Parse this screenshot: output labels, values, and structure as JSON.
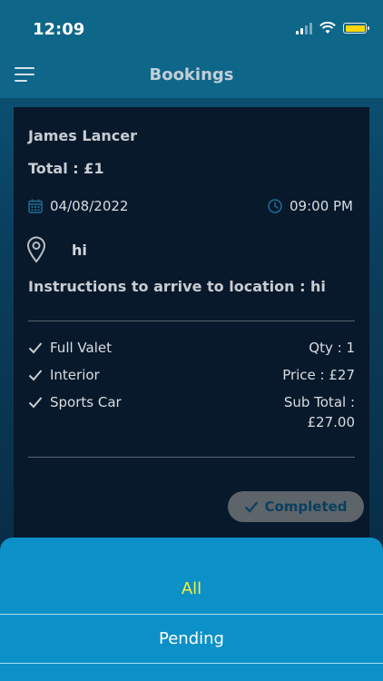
{
  "status_bar": {
    "time": "12:09"
  },
  "nav": {
    "title": "Bookings"
  },
  "booking": {
    "customer_name": "James Lancer",
    "total": "Total : £1",
    "date": "04/08/2022",
    "time": "09:00 PM",
    "location": "hi",
    "instructions": "Instructions to arrive to location : hi",
    "items": [
      {
        "label": "Full Valet"
      },
      {
        "label": "Interior"
      },
      {
        "label": "Sports Car"
      }
    ],
    "qty": "Qty : 1",
    "price": "Price : £27",
    "sub_total_label": "Sub Total :",
    "sub_total_value": "£27.00",
    "status": "Completed"
  },
  "filter_sheet": {
    "options": [
      {
        "label": "All",
        "selected": true
      },
      {
        "label": "Pending",
        "selected": false
      }
    ]
  },
  "colors": {
    "accent": "#0c90c8",
    "selected_option": "#f2f23a",
    "card_bg": "#08192b",
    "icon_blue": "#1e6d96"
  }
}
